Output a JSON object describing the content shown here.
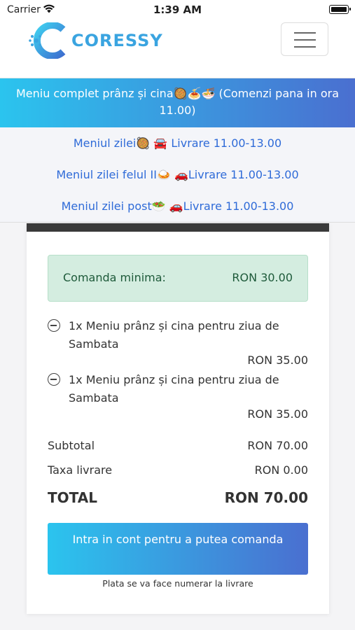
{
  "status_bar": {
    "carrier": "Carrier",
    "time": "1:39 AM"
  },
  "header": {
    "brand": "CORESSY"
  },
  "menu": {
    "active": "Meniu complet prânz și cina🥘🍝🍜 (Comenzi pana in ora 11.00)",
    "items": [
      "Meniul zilei🥘 🚘 Livrare 11.00-13.00",
      "Meniul zilei felul II🍛 🚗Livrare 11.00-13.00",
      "Meniul zilei post🥗 🚗Livrare 11.00-13.00"
    ]
  },
  "cart": {
    "min_order_label": "Comanda minima:",
    "min_order_value": "RON 30.00",
    "items": [
      {
        "name": "1x Meniu prânz și cina pentru ziua de Sambata",
        "price": "RON 35.00"
      },
      {
        "name": "1x Meniu prânz și cina pentru ziua de Sambata",
        "price": "RON 35.00"
      }
    ],
    "subtotal_label": "Subtotal",
    "subtotal_value": "RON 70.00",
    "delivery_label": "Taxa livrare",
    "delivery_value": "RON 0.00",
    "total_label": "TOTAL",
    "total_value": "RON 70.00",
    "login_button": "Intra in cont pentru a putea comanda",
    "payment_note": "Plata se va face numerar la livrare"
  },
  "colors": {
    "accent_start": "#2bc4ee",
    "accent_end": "#4a6fd0",
    "link": "#2f6bd8",
    "min_order_bg": "#d4ede0"
  }
}
